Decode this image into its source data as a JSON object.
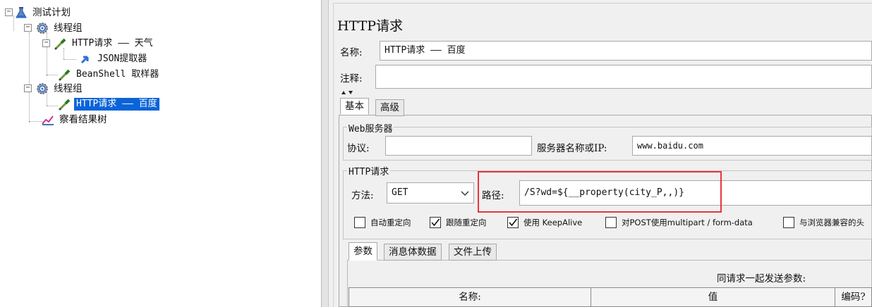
{
  "tree": {
    "nodes": [
      {
        "label": "测试计划",
        "icon": "test-plan-icon"
      },
      {
        "label": "线程组",
        "icon": "thread-group-icon"
      },
      {
        "label": "HTTP请求 —— 天气",
        "icon": "sampler-icon"
      },
      {
        "label": "JSON提取器",
        "icon": "extractor-icon"
      },
      {
        "label": "BeanShell 取样器",
        "icon": "sampler-icon"
      },
      {
        "label": "线程组",
        "icon": "thread-group-icon"
      },
      {
        "label": "HTTP请求 —— 百度",
        "icon": "sampler-icon",
        "selected": true
      },
      {
        "label": "察看结果树",
        "icon": "listener-icon"
      }
    ],
    "expander_symbol": "−"
  },
  "panel": {
    "title": "HTTP请求",
    "name_label": "名称:",
    "name_value": "HTTP请求 —— 百度",
    "comment_label": "注释:",
    "comment_value": "",
    "tabs": [
      "基本",
      "高级"
    ],
    "web_server": {
      "title": "Web服务器",
      "protocol_label": "协议:",
      "protocol_value": "",
      "server_label": "服务器名称或IP:",
      "server_value": "www.baidu.com"
    },
    "http_request": {
      "title": "HTTP请求",
      "method_label": "方法:",
      "method_value": "GET",
      "path_label": "路径:",
      "path_value": "/S?wd=${__property(city_P,,)}"
    },
    "checkboxes": [
      {
        "label": "自动重定向",
        "checked": false
      },
      {
        "label": "跟随重定向",
        "checked": true
      },
      {
        "label": "使用 KeepAlive",
        "checked": true
      },
      {
        "label": "对POST使用multipart / form-data",
        "checked": false
      },
      {
        "label": "与浏览器兼容的头",
        "checked": false
      }
    ],
    "sub_tabs": [
      "参数",
      "消息体数据",
      "文件上传"
    ],
    "params_caption": "同请求一起发送参数:",
    "table_headers": [
      "名称:",
      "值",
      "编码?"
    ]
  },
  "colors": {
    "selection": "#0a64d8",
    "highlight_box": "#e8353d"
  }
}
